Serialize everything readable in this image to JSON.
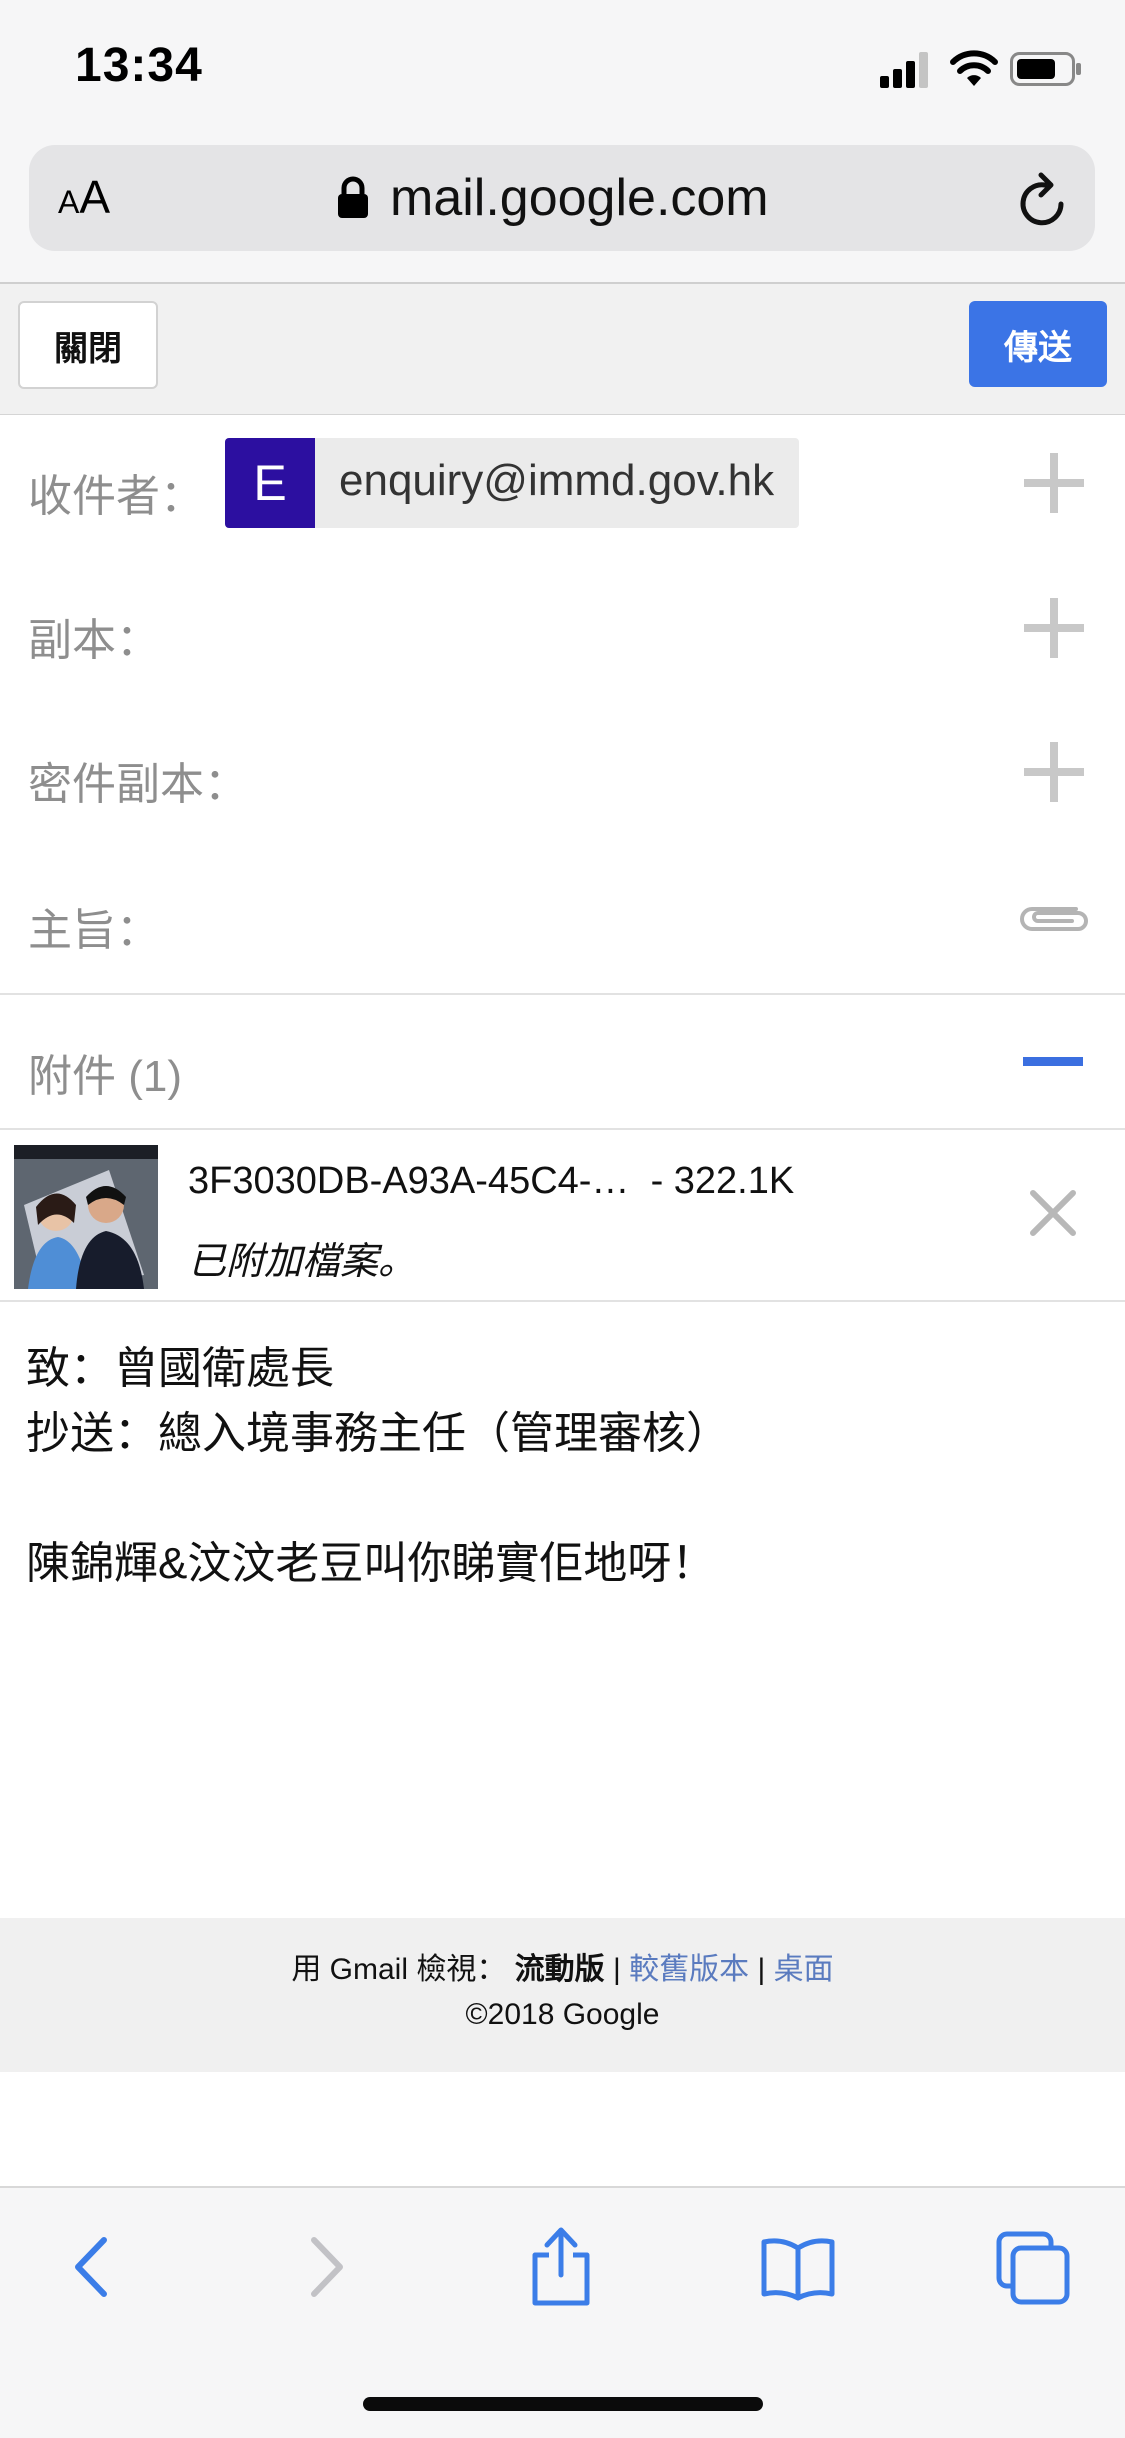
{
  "status_bar": {
    "time": "13:34"
  },
  "browser": {
    "text_size_label_small": "A",
    "text_size_label_large": "A",
    "url": "mail.google.com"
  },
  "toolbar": {
    "close_label": "關閉",
    "send_label": "傳送"
  },
  "fields": {
    "to_label": "收件者：",
    "to_recipient_initial": "E",
    "to_recipient_email": "enquiry@immd.gov.hk",
    "cc_label": "副本：",
    "bcc_label": "密件副本：",
    "subject_label": "主旨：",
    "attachments_label": "附件 (1)"
  },
  "attachment": {
    "filename": "3F3030DB-A93A-45C4-…",
    "size": "- 322.1K",
    "status": "已附加檔案。"
  },
  "body": {
    "line1": "致：曾國衛處長",
    "line2": "抄送：總入境事務主任（管理審核）",
    "line3": "",
    "line4": "陳錦輝&汶汶老豆叫你睇實佢地呀！"
  },
  "footer": {
    "view_prefix": "用 Gmail 檢視：",
    "mobile_label": "流動版",
    "separator": "|",
    "older_label": "較舊版本",
    "desktop_label": "桌面",
    "copyright": "©2018 Google"
  },
  "colors": {
    "accent": "#3b74e6",
    "avatar": "#2c0fa0",
    "link": "#5a7bbf",
    "safari_blue": "#3b7de8"
  },
  "icons": [
    "signal-icon",
    "wifi-icon",
    "battery-icon",
    "lock-icon",
    "reload-icon",
    "plus-icon",
    "paperclip-icon",
    "minus-icon",
    "close-x-icon",
    "back-icon",
    "forward-icon",
    "share-icon",
    "bookmarks-icon",
    "tabs-icon"
  ]
}
